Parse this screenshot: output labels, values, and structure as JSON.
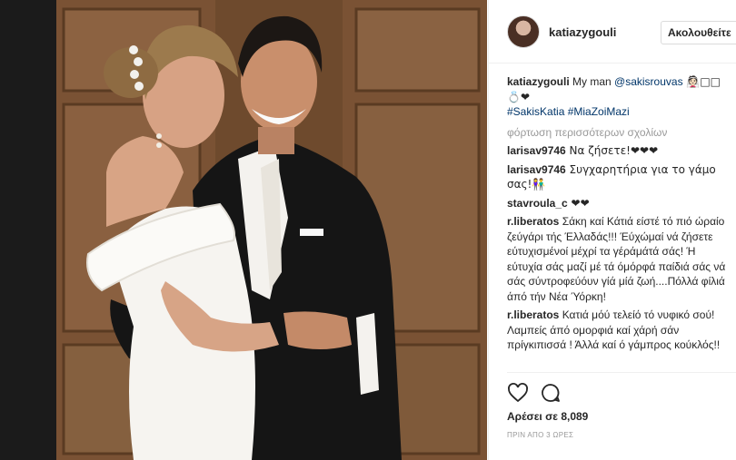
{
  "post": {
    "author": "katiazygouli",
    "follow_label": "Ακολουθείτε",
    "caption": {
      "user": "katiazygouli",
      "text": " My man ",
      "mention": "@sakisrouvas",
      "emojis_line1": " 👰🏻□□",
      "emojis_line2": "💍❤",
      "hashtags": "#SakisKatia #MiaZoiMazi"
    },
    "load_more": "φόρτωση περισσότερων σχολίων",
    "comments": [
      {
        "user": "larisav9746",
        "text": " Να ζήσετε!❤❤❤"
      },
      {
        "user": "larisav9746",
        "text": " Συγχαρητήρια για το γάμο σας!👫"
      },
      {
        "user": "stavroula_c",
        "text": " ❤❤"
      },
      {
        "user": "r.liberatos",
        "text": " Σάκη καί Κάτιά είστέ τό πιό ώραίο ζεύγάρι τής Έλλαδάς!!! Έύχώμαί νά ζήσετε εύτυχισμένοί μέχρί τα γέράμάτά σάς! Ή εύτυχία σάς μαζί μέ τά όμόρφά παίδιά σάς νά σάς σύντροφεύόυν γίά μίά ζωή....Πόλλά φίλιά άπό τήν Νέα Ύόρκη!"
      },
      {
        "user": "r.liberatos",
        "text": " Κατιά μόύ τελείό τό νυφικό σού! Λαμπείς άπό ομορφιά καί χάρή σάν πρίγκιπισσά ! Άλλά καί ό γάμπρος κούκλός!!"
      }
    ],
    "likes": "Αρέσει σε 8,089",
    "time_ago": "ΠΡΙΝ ΑΠΟ 3 ΩΡΕΣ"
  },
  "icons": {
    "like": "heart-icon",
    "comment": "comment-bubble-icon"
  },
  "colors": {
    "link": "#003569",
    "muted": "#999999",
    "text": "#262626",
    "border": "#efefef"
  }
}
